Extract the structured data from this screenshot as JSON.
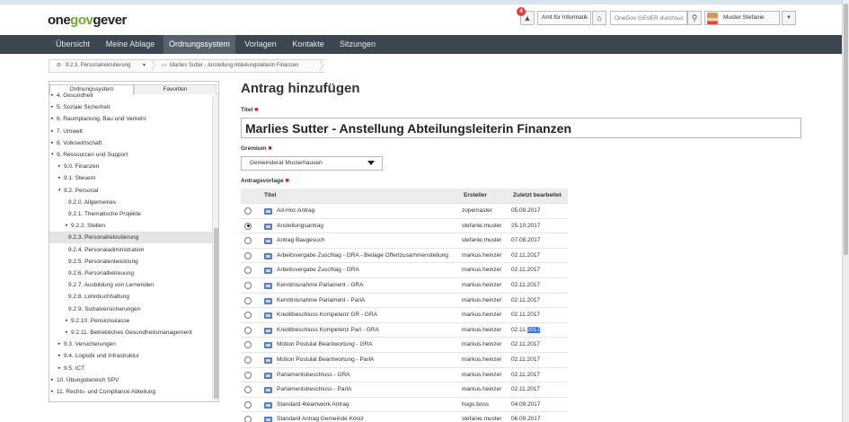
{
  "header": {
    "logo": {
      "one": "one",
      "gov": "gov",
      "gever": "gever"
    },
    "notification_count": "4",
    "org_unit": "Amt für Informatik",
    "search_placeholder": "OneGov GEVER durchsuc",
    "user_name": "Muster Stefanie"
  },
  "nav": {
    "tabs": [
      "Übersicht",
      "Meine Ablage",
      "Ordnungssystem",
      "Vorlagen",
      "Kontakte",
      "Sitzungen"
    ],
    "active": "Ordnungssystem"
  },
  "breadcrumb": {
    "items": [
      "9.2.3. Personalrekrutierung",
      "Marlies Sutter - Anstellung Abteilungsleiterin Finanzen"
    ]
  },
  "sidebar": {
    "tabs": [
      "Ordnungssystem",
      "Favoriten"
    ],
    "active_tab": "Ordnungssystem",
    "tree": [
      {
        "label": "4. Gesundheit",
        "level": 0,
        "arrow": "▸"
      },
      {
        "label": "5. Soziale Sicherheit",
        "level": 0,
        "arrow": "▸"
      },
      {
        "label": "6. Raumplanung, Bau und Verkehr",
        "level": 0,
        "arrow": "▸"
      },
      {
        "label": "7. Umwelt",
        "level": 0,
        "arrow": "▸"
      },
      {
        "label": "8. Volkswirtschaft",
        "level": 0,
        "arrow": "▸"
      },
      {
        "label": "9. Ressourcen und Support",
        "level": 0,
        "arrow": "▾"
      },
      {
        "label": "9.0. Finanzen",
        "level": 1,
        "arrow": "▸"
      },
      {
        "label": "9.1. Steuern",
        "level": 1,
        "arrow": "▸"
      },
      {
        "label": "9.2. Personal",
        "level": 1,
        "arrow": "▾"
      },
      {
        "label": "9.2.0. Allgemeines",
        "level": 2,
        "arrow": ""
      },
      {
        "label": "9.2.1. Thematische Projekte",
        "level": 2,
        "arrow": ""
      },
      {
        "label": "9.2.2. Stellen",
        "level": 2,
        "arrow": "▸"
      },
      {
        "label": "9.2.3. Personalrekrutierung",
        "level": 2,
        "arrow": "",
        "selected": true
      },
      {
        "label": "9.2.4. Personaladministration",
        "level": 2,
        "arrow": ""
      },
      {
        "label": "9.2.5. Personalentwicklung",
        "level": 2,
        "arrow": ""
      },
      {
        "label": "9.2.6. Personalbetreuung",
        "level": 2,
        "arrow": ""
      },
      {
        "label": "9.2.7. Ausbildung von Lernenden",
        "level": 2,
        "arrow": ""
      },
      {
        "label": "9.2.8. Lohnbuchhaltung",
        "level": 2,
        "arrow": ""
      },
      {
        "label": "9.2.9. Sozialversicherungen",
        "level": 2,
        "arrow": ""
      },
      {
        "label": "9.2.10. Pensionskasse",
        "level": 2,
        "arrow": "▸"
      },
      {
        "label": "9.2.11. Betriebliches Gesundheitsmanagement",
        "level": 2,
        "arrow": "▸"
      },
      {
        "label": "9.3. Versicherungen",
        "level": 1,
        "arrow": "▸"
      },
      {
        "label": "9.4. Logistik und Infrastruktur",
        "level": 1,
        "arrow": "▸"
      },
      {
        "label": "9.5. ICT",
        "level": 1,
        "arrow": "▸"
      },
      {
        "label": "10. Übungsbereich SPV",
        "level": 0,
        "arrow": "▸"
      },
      {
        "label": "11. Rechts- und Compliance Abteilung",
        "level": 0,
        "arrow": "▸"
      }
    ]
  },
  "main": {
    "heading": "Antrag hinzufügen",
    "title_label": "Titel",
    "title_value": "Marlies Sutter - Anstellung Abteilungsleiterin Finanzen",
    "gremium_label": "Gremium",
    "gremium_value": "Gemeinderat Musterhausen",
    "vorlage_label": "Antragsvorlage",
    "columns": [
      "Titel",
      "Ersteller",
      "Zuletzt bearbeitet"
    ],
    "rows": [
      {
        "title": "Ad-Hoc Antrag",
        "creator": "zopemaster",
        "date": "05.09.2017",
        "checked": false
      },
      {
        "title": "Anstellungsantrag",
        "creator": "stefanie.muster",
        "date": "25.10.2017",
        "checked": true
      },
      {
        "title": "Antrag Baugesuch",
        "creator": "stefanie.muster",
        "date": "07.08.2017",
        "checked": false
      },
      {
        "title": "Arbeitsvergabe Zuschlag - GRA - Beilage Offertzusammenstellung",
        "creator": "markus.heinzer",
        "date": "02.11.2017",
        "checked": false
      },
      {
        "title": "Arbeitsvergabe Zuschlag - GRA",
        "creator": "markus.heinzer",
        "date": "02.11.2017",
        "checked": false
      },
      {
        "title": "Kenntnisnahme Parlament - GRA",
        "creator": "markus.heinzer",
        "date": "02.11.2017",
        "checked": false
      },
      {
        "title": "Kenntnisnahme Parlament - ParlA",
        "creator": "markus.heinzer",
        "date": "02.11.2017",
        "checked": false
      },
      {
        "title": "Kreditbeschluss Kompetenz GR - GRA",
        "creator": "markus.heinzer",
        "date": "02.11.2017",
        "checked": false
      },
      {
        "title": "Kreditbeschluss Kompetenz Parl - GRA",
        "creator": "markus.heinzer",
        "date_pre": "02.11.",
        "date_hl": "2017",
        "checked": false
      },
      {
        "title": "Motion Postulat Beantwortung - GRA",
        "creator": "markus.heinzer",
        "date": "02.11.2017",
        "checked": false
      },
      {
        "title": "Motion Postulat Beantwortung - ParlA",
        "creator": "markus.heinzer",
        "date": "02.11.2017",
        "checked": false
      },
      {
        "title": "Parlamentsbeschluss - GRA",
        "creator": "markus.heinzer",
        "date": "02.11.2017",
        "checked": false
      },
      {
        "title": "Parlamentsbeschluss - ParlA",
        "creator": "markus.heinzer",
        "date": "02.11.2017",
        "checked": false
      },
      {
        "title": "Standard 4teamwork Antrag",
        "creator": "hugo.boss",
        "date": "04.09.2017",
        "checked": false
      },
      {
        "title": "Standard Antrag Gemeinde Köniz",
        "creator": "stefanie.muster",
        "date": "06.09.2017",
        "checked": false
      }
    ]
  },
  "colors": {
    "nav_bg": "#3c4650",
    "nav_active": "#56616d",
    "accent_green": "#6cab2e",
    "required": "#e02020"
  }
}
